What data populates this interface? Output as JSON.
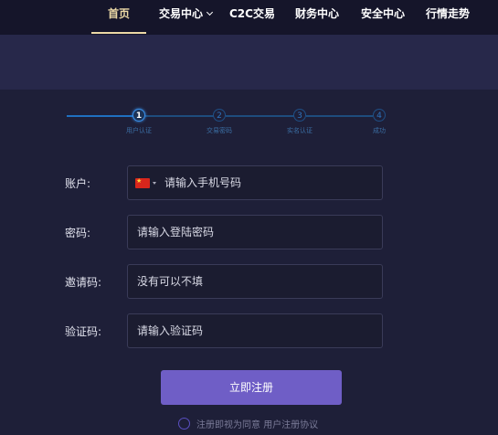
{
  "nav": {
    "items": [
      "首页",
      "交易中心",
      "C2C交易",
      "财务中心",
      "安全中心",
      "行情走势"
    ],
    "active_index": 0
  },
  "stepper": {
    "steps": [
      {
        "number": "1",
        "label": "用户认证"
      },
      {
        "number": "2",
        "label": "交易密码"
      },
      {
        "number": "3",
        "label": "实名认证"
      },
      {
        "number": "4",
        "label": "成功"
      }
    ],
    "current": 1
  },
  "form": {
    "account": {
      "label": "账户:",
      "placeholder": "请输入手机号码"
    },
    "password": {
      "label": "密码:",
      "placeholder": "请输入登陆密码"
    },
    "invite": {
      "label": "邀请码:",
      "placeholder": "没有可以不填"
    },
    "captcha": {
      "label": "验证码:",
      "placeholder": "请输入验证码"
    },
    "submit_label": "立即注册"
  },
  "agreement": {
    "prefix": "注册即视为同意",
    "link": "用户注册协议"
  },
  "colors": {
    "page_bg": "#1e1f38",
    "nav_bg": "#15152a",
    "banner_bg": "#27284a",
    "nav_active": "#ecd9a6",
    "step_blue": "#1f6fc0",
    "button": "#6f5ec6"
  },
  "icons": {
    "country_flag": "cn-flag-icon",
    "nav_dropdown": "chevron-down-icon"
  }
}
